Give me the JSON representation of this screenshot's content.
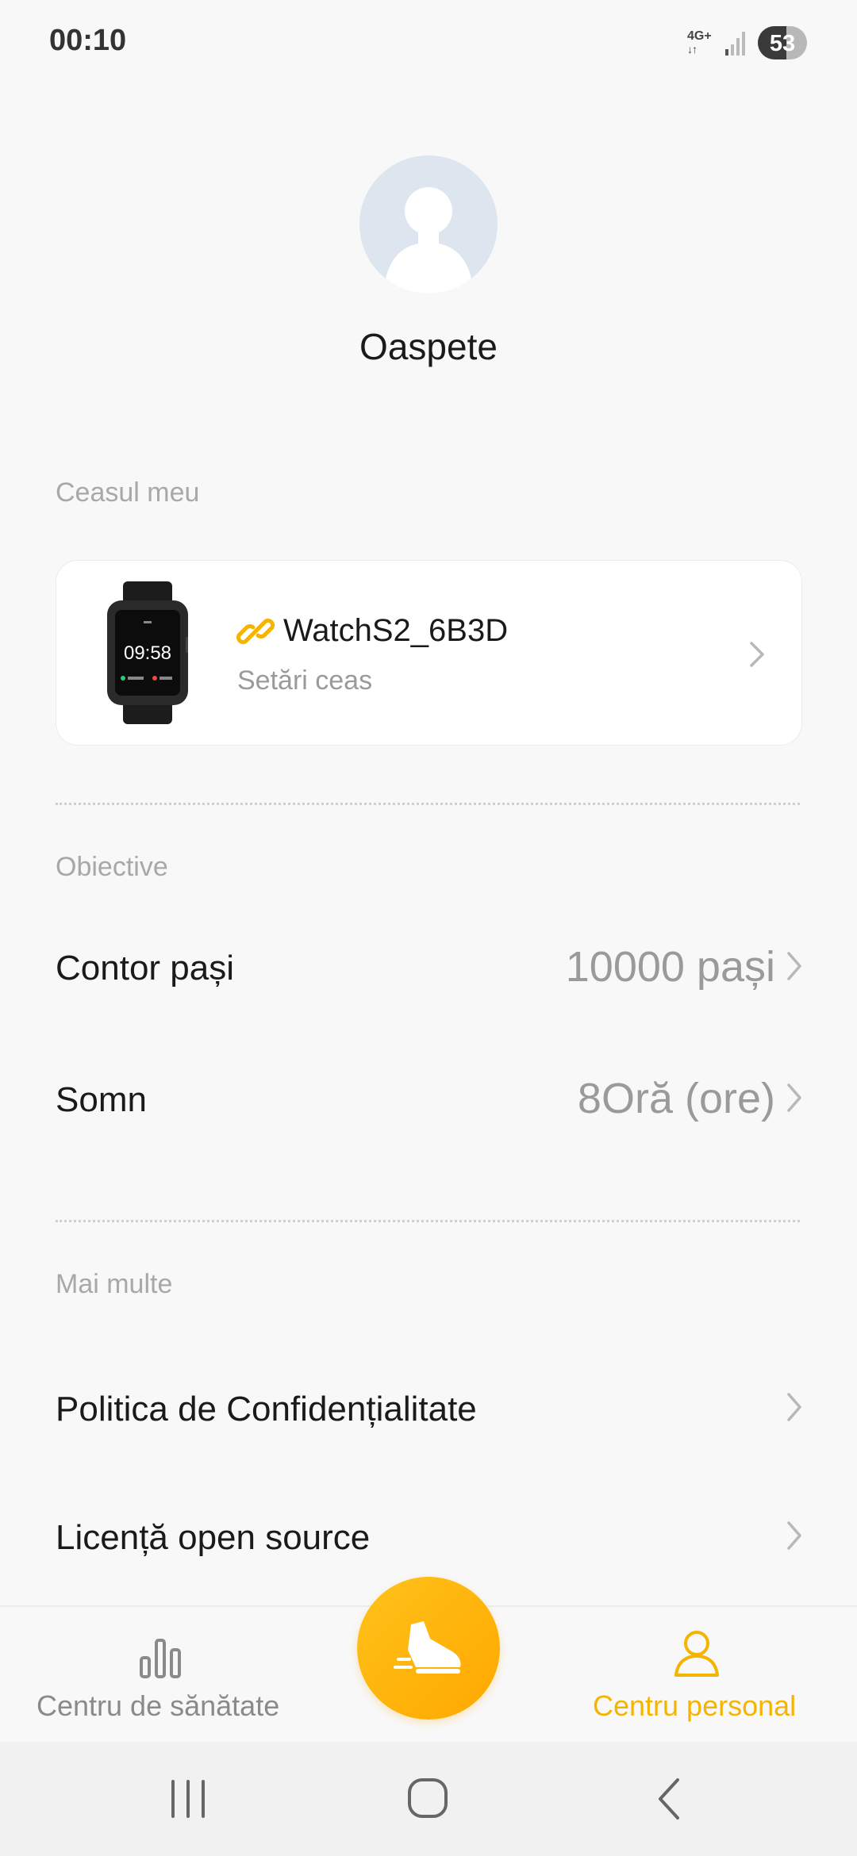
{
  "status_bar": {
    "time": "00:10",
    "network": "4G+",
    "battery": "53"
  },
  "profile": {
    "name": "Oaspete"
  },
  "my_watch": {
    "section_label": "Ceasul meu",
    "watch_face_time": "09:58",
    "device_name": "WatchS2_6B3D",
    "settings_label": "Setări ceas",
    "link_color": "#f5b400"
  },
  "goals": {
    "section_label": "Obiective",
    "items": [
      {
        "label": "Contor pași",
        "value": "10000 pași"
      },
      {
        "label": "Somn",
        "value": "8Oră (ore)"
      }
    ]
  },
  "more": {
    "section_label": "Mai multe",
    "items": [
      {
        "label": "Politica de Confidențialitate"
      },
      {
        "label": "Licență open source"
      }
    ]
  },
  "bottom_nav": {
    "tabs": [
      {
        "label": "Centru de sănătate",
        "icon": "bar-chart-icon",
        "active": false
      },
      {
        "label": "Centru personal",
        "icon": "person-icon",
        "active": true
      }
    ],
    "center_button_icon": "running-shoe-icon",
    "accent_color": "#f5b400",
    "inactive_color": "#8a8a8a"
  },
  "system_nav": {
    "buttons": [
      "recents-icon",
      "home-icon",
      "back-icon"
    ]
  }
}
